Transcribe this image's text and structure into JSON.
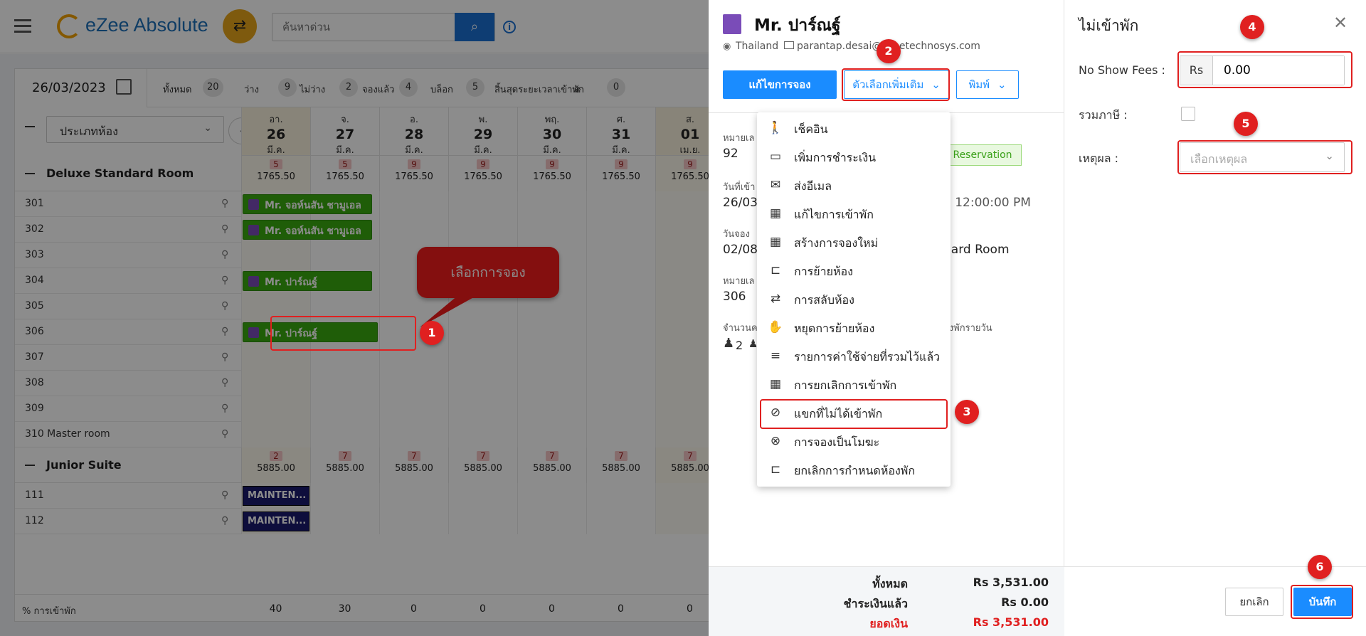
{
  "app": {
    "logo_text": "eZee Absolute",
    "search_placeholder": "ค้นหาด่วน"
  },
  "calendar": {
    "date": "26/03/2023",
    "stats": [
      {
        "label": "ทั้งหมด",
        "count": "20"
      },
      {
        "label": "ว่าง",
        "count": "9"
      },
      {
        "label": "ไม่ว่าง",
        "count": "2"
      },
      {
        "label": "จองแล้ว",
        "count": "4"
      },
      {
        "label": "บล็อก",
        "count": "5"
      },
      {
        "label": "สิ้นสุดระยะเวลาเข้าพัก",
        "count": "0"
      },
      {
        "label": "ส",
        "count": ""
      }
    ],
    "room_type_select": "ประเภทห้อง",
    "days": [
      {
        "dow": "อา.",
        "day": "26",
        "mon": "มี.ค."
      },
      {
        "dow": "จ.",
        "day": "27",
        "mon": "มี.ค."
      },
      {
        "dow": "อ.",
        "day": "28",
        "mon": "มี.ค."
      },
      {
        "dow": "พ.",
        "day": "29",
        "mon": "มี.ค."
      },
      {
        "dow": "พฤ.",
        "day": "30",
        "mon": "มี.ค."
      },
      {
        "dow": "ศ.",
        "day": "31",
        "mon": "มี.ค."
      },
      {
        "dow": "ส.",
        "day": "01",
        "mon": "เม.ย."
      }
    ],
    "groups": [
      {
        "name": "Deluxe Standard Room",
        "avail": [
          "5",
          "5",
          "9",
          "9",
          "9",
          "9",
          "9"
        ],
        "rates": [
          "1765.50",
          "1765.50",
          "1765.50",
          "1765.50",
          "1765.50",
          "1765.50",
          "1765.50"
        ],
        "rooms": [
          "301",
          "302",
          "303",
          "304",
          "305",
          "306",
          "307",
          "308",
          "309",
          "310 Master room"
        ]
      },
      {
        "name": "Junior Suite",
        "avail": [
          "2",
          "7",
          "7",
          "7",
          "7",
          "7",
          "7"
        ],
        "rates": [
          "5885.00",
          "5885.00",
          "5885.00",
          "5885.00",
          "5885.00",
          "5885.00",
          "5885.00"
        ],
        "rooms": [
          "111",
          "112"
        ]
      }
    ],
    "bookings": [
      "Mr. จอห์นสัน ชามูเอล",
      "Mr. จอห์นสัน ชามูเอล",
      "Mr. ปาร์ณฐ์",
      "Mr. ปาร์ณฐ์"
    ],
    "maintenance": [
      "MAINTEN...",
      "MAINTEN..."
    ],
    "occupancy": {
      "label": "% การเข้าพัก",
      "values": [
        "40",
        "30",
        "0",
        "0",
        "0",
        "0",
        "0"
      ]
    },
    "tooltip": "เลือกการจอง"
  },
  "detail": {
    "guest_name": "Mr. ปาร์ณฐ์",
    "country": "Thailand",
    "email": "parantap.desai@ezeetechnosys.com",
    "edit_button": "แก้ไขการจอง",
    "more_button": "ตัวเลือกเพิ่มเติม",
    "print_button": "พิมพ์",
    "res_no_label": "หมายเล",
    "res_no": "92",
    "status_badge": "Reservation",
    "checkin_label": "วันที่เข้า",
    "checkin_value": "26/03,",
    "checkout_value": "3 12:00:00 PM",
    "booked_label": "วันจอง",
    "booked_value": "02/08,",
    "room_type_value": "dard Room",
    "room_no_label": "หมายเล",
    "room_no": "306",
    "guests_label": "จำนวนค",
    "rate_type": "้องพักรายวัน",
    "guests_value": "2",
    "summary": [
      {
        "label": "ทั้งหมด",
        "value": "Rs 3,531.00"
      },
      {
        "label": "ชำระเงินแล้ว",
        "value": "Rs 0.00"
      },
      {
        "label": "ยอดเงิน",
        "value": "Rs 3,531.00"
      }
    ]
  },
  "menu": {
    "items": [
      {
        "label": "เช็คอิน",
        "icon": "walk-in-icon"
      },
      {
        "label": "เพิ่มการชำระเงิน",
        "icon": "card-icon"
      },
      {
        "label": "ส่งอีเมล",
        "icon": "mail-icon"
      },
      {
        "label": "แก้ไขการเข้าพัก",
        "icon": "calendar-edit-icon"
      },
      {
        "label": "สร้างการจองใหม่",
        "icon": "calendar-icon"
      },
      {
        "label": "การย้ายห้อง",
        "icon": "bed-move-icon"
      },
      {
        "label": "การสลับห้อง",
        "icon": "swap-icon"
      },
      {
        "label": "หยุดการย้ายห้อง",
        "icon": "hand-icon"
      },
      {
        "label": "รายการค่าใช้จ่ายที่รวมไว้แล้ว",
        "icon": "tray-icon"
      },
      {
        "label": "การยกเลิกการเข้าพัก",
        "icon": "calendar-cancel-icon"
      },
      {
        "label": "แขกที่ไม่ได้เข้าพัก",
        "icon": "eye-off-icon"
      },
      {
        "label": "การจองเป็นโมฆะ",
        "icon": "x-circle-icon"
      },
      {
        "label": "ยกเลิกการกำหนดห้องพัก",
        "icon": "bed-cancel-icon"
      }
    ]
  },
  "noshow": {
    "title": "ไม่เข้าพัก",
    "fees_label": "No Show Fees :",
    "currency": "Rs",
    "fees_value": "0.00",
    "tax_label": "รวมภาษี :",
    "reason_label": "เหตุผล :",
    "reason_placeholder": "เลือกเหตุผล",
    "cancel_button": "ยกเลิก",
    "save_button": "บันทึก"
  },
  "callouts": [
    "1",
    "2",
    "3",
    "4",
    "5",
    "6"
  ],
  "colors": {
    "primary": "#1a8cff",
    "booking_green": "#3aaa0f",
    "highlight_red": "#e02020",
    "maintenance": "#1a1a6e"
  }
}
